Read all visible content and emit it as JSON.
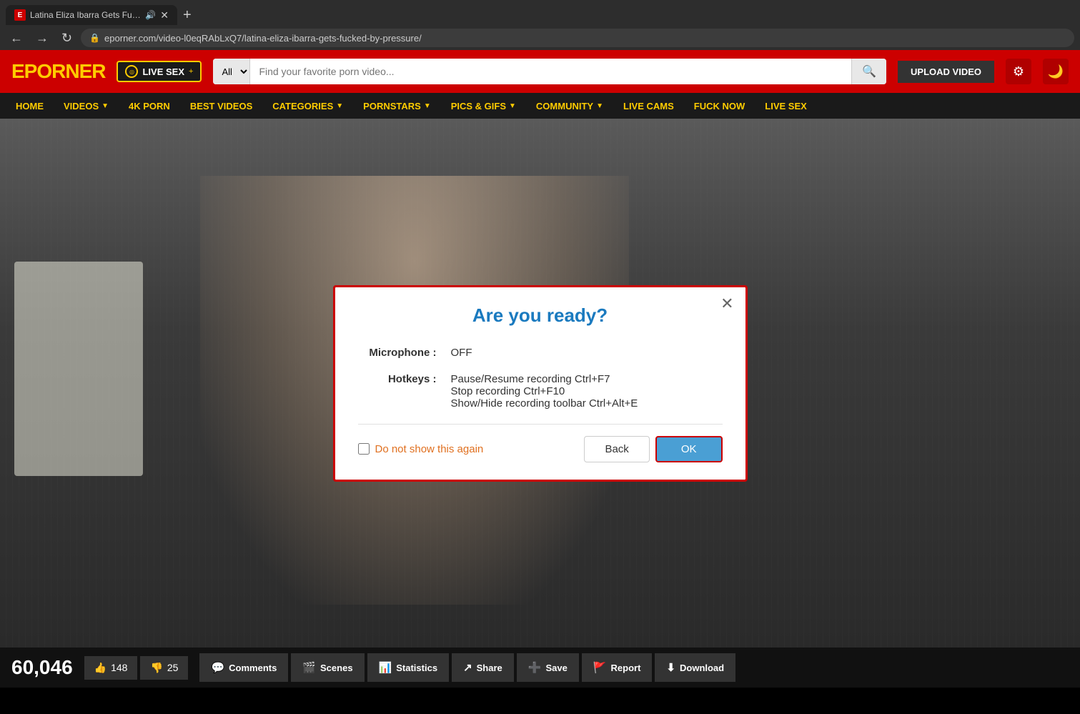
{
  "browser": {
    "tab_favicon": "E",
    "tab_title": "Latina Eliza Ibarra Gets Fuck...",
    "tab_has_audio": true,
    "new_tab_label": "+",
    "nav_back": "←",
    "nav_forward": "→",
    "nav_reload": "↻",
    "address_url": "eporner.com/video-l0eqRAbLxQ7/latina-eliza-ibarra-gets-fucked-by-pressure/"
  },
  "header": {
    "logo_text": "EPORNER",
    "live_sex_label": "LIVE SEX",
    "live_badge_symbol": "◎",
    "live_plus": "+",
    "search_placeholder": "Find your favorite porn video...",
    "search_all": "All",
    "upload_label": "UPLOAD VIDEO",
    "settings_icon": "⚙",
    "moon_icon": "🌙"
  },
  "nav": {
    "items": [
      {
        "label": "HOME",
        "has_arrow": false
      },
      {
        "label": "VIDEOS",
        "has_arrow": true
      },
      {
        "label": "4K PORN",
        "has_arrow": false
      },
      {
        "label": "BEST VIDEOS",
        "has_arrow": false
      },
      {
        "label": "CATEGORIES",
        "has_arrow": true
      },
      {
        "label": "PORNSTARS",
        "has_arrow": true
      },
      {
        "label": "PICS & GIFS",
        "has_arrow": true
      },
      {
        "label": "COMMUNITY",
        "has_arrow": true
      },
      {
        "label": "LIVE CAMS",
        "has_arrow": false
      },
      {
        "label": "FUCK NOW",
        "has_arrow": false
      },
      {
        "label": "LIVE SEX",
        "has_arrow": false
      }
    ]
  },
  "dialog": {
    "title": "Are you ready?",
    "close_icon": "✕",
    "microphone_label": "Microphone :",
    "microphone_value": "OFF",
    "hotkeys_label": "Hotkeys :",
    "hotkey1": "Pause/Resume recording Ctrl+F7",
    "hotkey2": "Stop recording Ctrl+F10",
    "hotkey3": "Show/Hide recording toolbar Ctrl+Alt+E",
    "dont_show_label": "Do not show this again",
    "back_label": "Back",
    "ok_label": "OK"
  },
  "bottom_bar": {
    "view_count": "60,046",
    "like_icon": "👍",
    "like_count": "148",
    "dislike_icon": "👎",
    "dislike_count": "25",
    "comments_icon": "💬",
    "comments_label": "Comments",
    "scenes_icon": "🎬",
    "scenes_label": "Scenes",
    "statistics_icon": "📊",
    "statistics_label": "Statistics",
    "share_icon": "⬡",
    "share_label": "Share",
    "save_icon": "➕",
    "save_label": "Save",
    "report_icon": "🚩",
    "report_label": "Report",
    "download_icon": "⬇",
    "download_label": "Download"
  }
}
